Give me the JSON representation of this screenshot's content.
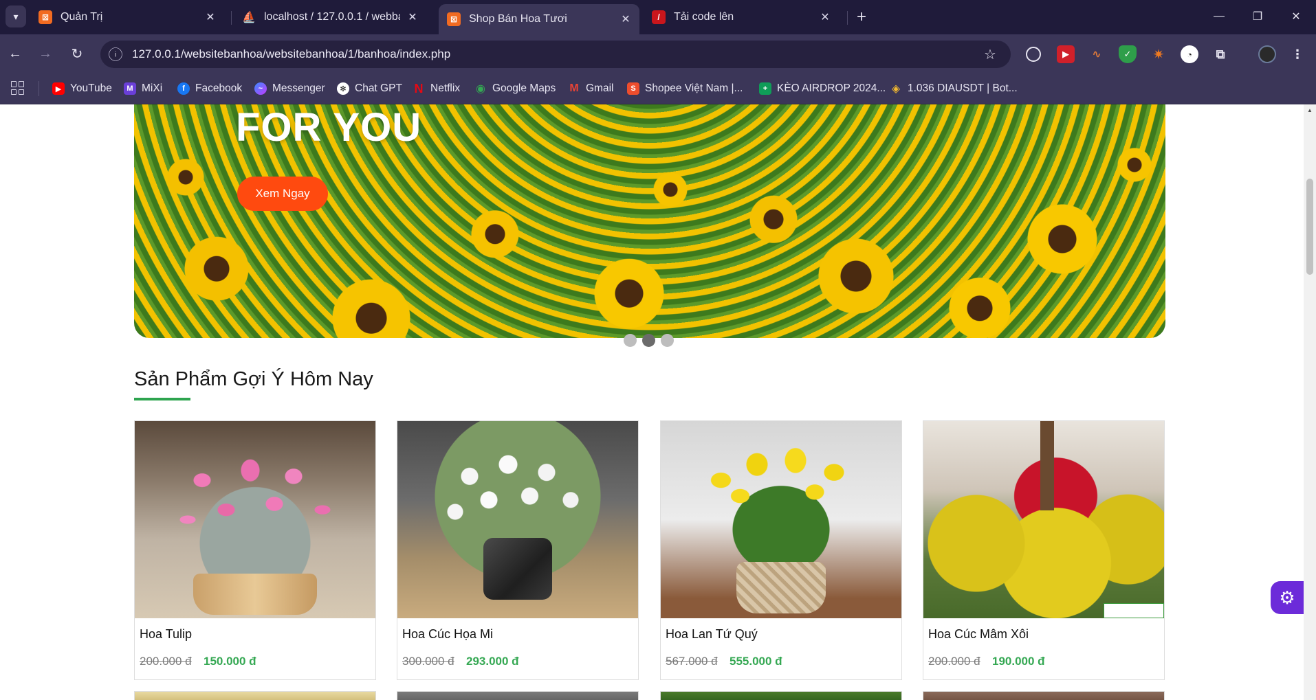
{
  "browser": {
    "tabs": [
      {
        "title": "Quản Trị",
        "favicon": "xampp-icon",
        "color": "#f26b21"
      },
      {
        "title": "localhost / 127.0.0.1 / webbanh",
        "favicon": "phpmyadmin-icon",
        "color": "#f2a300"
      },
      {
        "title": "Shop Bán Hoa Tươi",
        "favicon": "xampp-icon",
        "color": "#f26b21"
      },
      {
        "title": "Tải code lên",
        "favicon": "page-icon",
        "color": "#c9161c"
      }
    ],
    "address": "127.0.0.1/websitebanhoa/websitebanhoa/1/banhoa/index.php",
    "bookmarks": [
      {
        "label": "YouTube",
        "icon": "youtube-icon",
        "color": "#ff0000"
      },
      {
        "label": "MiXi",
        "icon": "mixi-icon",
        "color": "#6a3fd8"
      },
      {
        "label": "Facebook",
        "icon": "facebook-icon",
        "color": "#1877f2"
      },
      {
        "label": "Messenger",
        "icon": "messenger-icon",
        "color": "#a43ff0"
      },
      {
        "label": "Chat GPT",
        "icon": "chatgpt-icon",
        "color": "#ffffff"
      },
      {
        "label": "Netflix",
        "icon": "netflix-icon",
        "color": "#e50914"
      },
      {
        "label": "Google Maps",
        "icon": "maps-icon",
        "color": "#34a853"
      },
      {
        "label": "Gmail",
        "icon": "gmail-icon",
        "color": "#ea4335"
      },
      {
        "label": "Shopee Việt Nam |...",
        "icon": "shopee-icon",
        "color": "#ee4d2d"
      },
      {
        "label": "KÈO AIRDROP 2024...",
        "icon": "sheets-icon",
        "color": "#0f9d58"
      },
      {
        "label": "1.036 DIAUSDT | Bot...",
        "icon": "binance-icon",
        "color": "#f3ba2f"
      }
    ]
  },
  "hero": {
    "title": "FOR YOU",
    "button": "Xem Ngay",
    "slides": 3,
    "active_slide": 2
  },
  "section": {
    "title": "Sản Phẩm Gợi Ý Hôm Nay"
  },
  "products": [
    {
      "name": "Hoa Tulip",
      "old_price": "200.000 đ",
      "price": "150.000 đ"
    },
    {
      "name": "Hoa Cúc Họa Mi",
      "old_price": "300.000 đ",
      "price": "293.000 đ"
    },
    {
      "name": "Hoa Lan Tứ Quý",
      "old_price": "567.000 đ",
      "price": "555.000 đ"
    },
    {
      "name": "Hoa Cúc Mâm Xôi",
      "old_price": "200.000 đ",
      "price": "190.000 đ"
    }
  ],
  "colors": {
    "accent": "#35a853",
    "hero_button": "#ff4a0f",
    "float_button": "#6c2bd9"
  }
}
